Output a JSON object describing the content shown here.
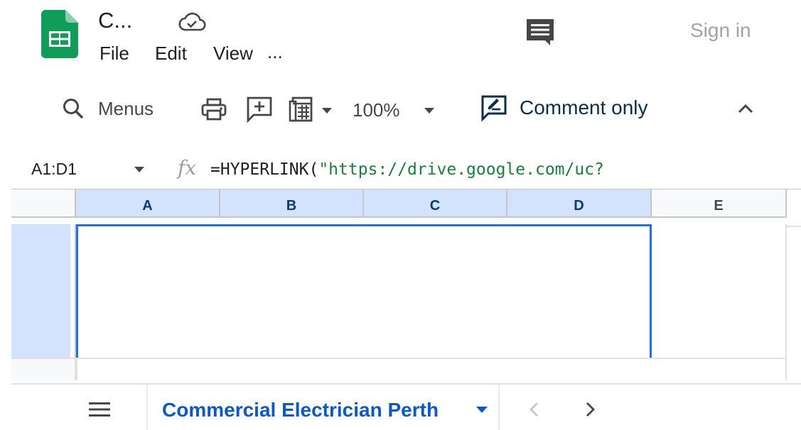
{
  "app": {
    "document_title": "C...",
    "sign_in_label": "Sign in"
  },
  "menu": {
    "items": [
      "File",
      "Edit",
      "View",
      "..."
    ]
  },
  "toolbar": {
    "menus_label": "Menus",
    "zoom": "100%",
    "mode_label": "Comment only"
  },
  "formula_bar": {
    "name_box": "A1:D1",
    "fx_label": "fx",
    "formula_prefix": "=HYPERLINK(",
    "formula_string": "\"https://drive.google.com/uc?"
  },
  "grid": {
    "columns": [
      "A",
      "B",
      "C",
      "D",
      "E"
    ],
    "selected_columns": [
      "A",
      "B",
      "C",
      "D"
    ]
  },
  "sheets": {
    "active_tab": "Commercial Electrician Perth"
  },
  "colors": {
    "brand_green": "#0f9d58",
    "selection_blue": "#1a73e8",
    "header_selected_bg": "#d3e3fd",
    "tab_active_text": "#0b57d0"
  },
  "icons": [
    "sheets-logo-icon",
    "cloud-saved-icon",
    "comment-history-icon",
    "search-icon",
    "print-icon",
    "add-comment-icon",
    "sheet-view-icon",
    "dropdown-arrow-icon",
    "edit-mode-icon",
    "collapse-chevron-icon",
    "all-sheets-icon",
    "chevron-left-icon",
    "chevron-right-icon"
  ]
}
